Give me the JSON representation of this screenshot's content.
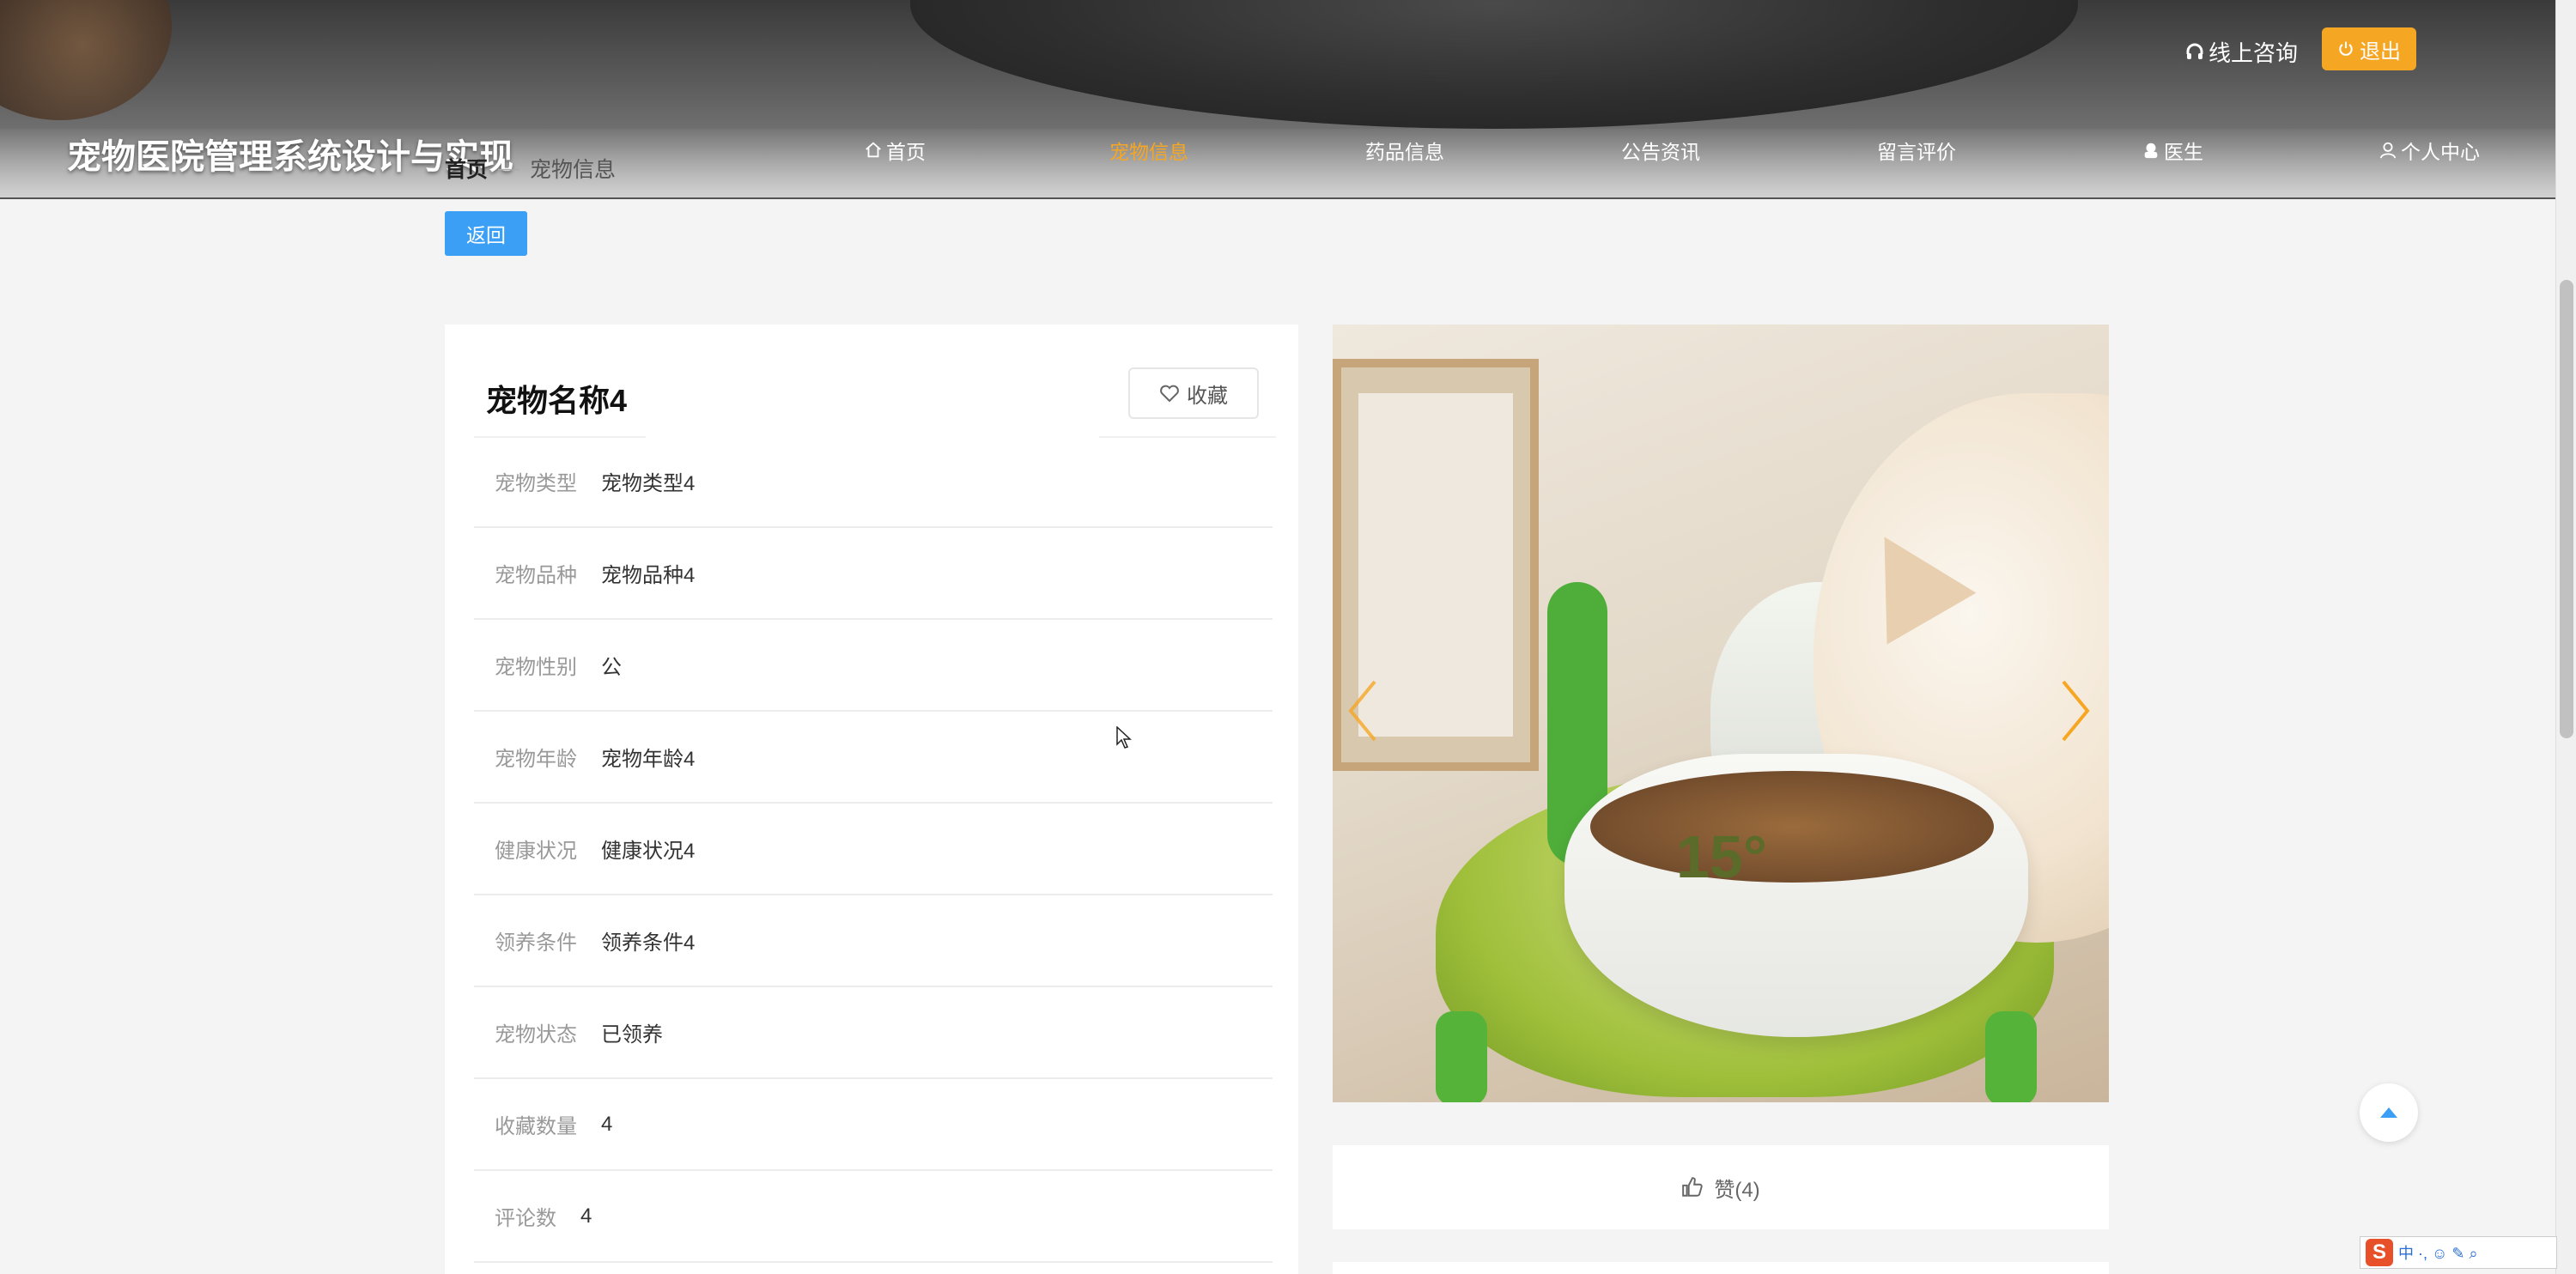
{
  "site": {
    "title": "宠物医院管理系统设计与实现"
  },
  "nav": {
    "items": [
      {
        "label": "首页",
        "icon": "home-icon"
      },
      {
        "label": "宠物信息",
        "active": true
      },
      {
        "label": "药品信息"
      },
      {
        "label": "公告资讯"
      },
      {
        "label": "留言评价"
      },
      {
        "label": "医生",
        "icon": "doctor-icon"
      },
      {
        "label": "个人中心",
        "icon": "user-icon"
      }
    ]
  },
  "top_actions": {
    "consult_label": "线上咨询",
    "logout_label": "退出"
  },
  "breadcrumb": {
    "home": "首页",
    "separator": "—",
    "current": "宠物信息"
  },
  "back_label": "返回",
  "pet": {
    "name": "宠物名称4",
    "favorite_label": "收藏",
    "fields": [
      {
        "label": "宠物类型",
        "value": "宠物类型4"
      },
      {
        "label": "宠物品种",
        "value": "宠物品种4"
      },
      {
        "label": "宠物性别",
        "value": "公"
      },
      {
        "label": "宠物年龄",
        "value": "宠物年龄4"
      },
      {
        "label": "健康状况",
        "value": "健康状况4"
      },
      {
        "label": "领养条件",
        "value": "领养条件4"
      },
      {
        "label": "宠物状态",
        "value": "已领养"
      },
      {
        "label": "收藏数量",
        "value": "4"
      },
      {
        "label": "评论数",
        "value": "4"
      }
    ]
  },
  "carousel": {
    "angle_text": "15°"
  },
  "like": {
    "label": "赞(4)"
  },
  "ime": {
    "chars": "中 ·, ☺ ✎ ⌕"
  },
  "colors": {
    "accent": "#f6a623",
    "primary": "#3a9ff5"
  }
}
